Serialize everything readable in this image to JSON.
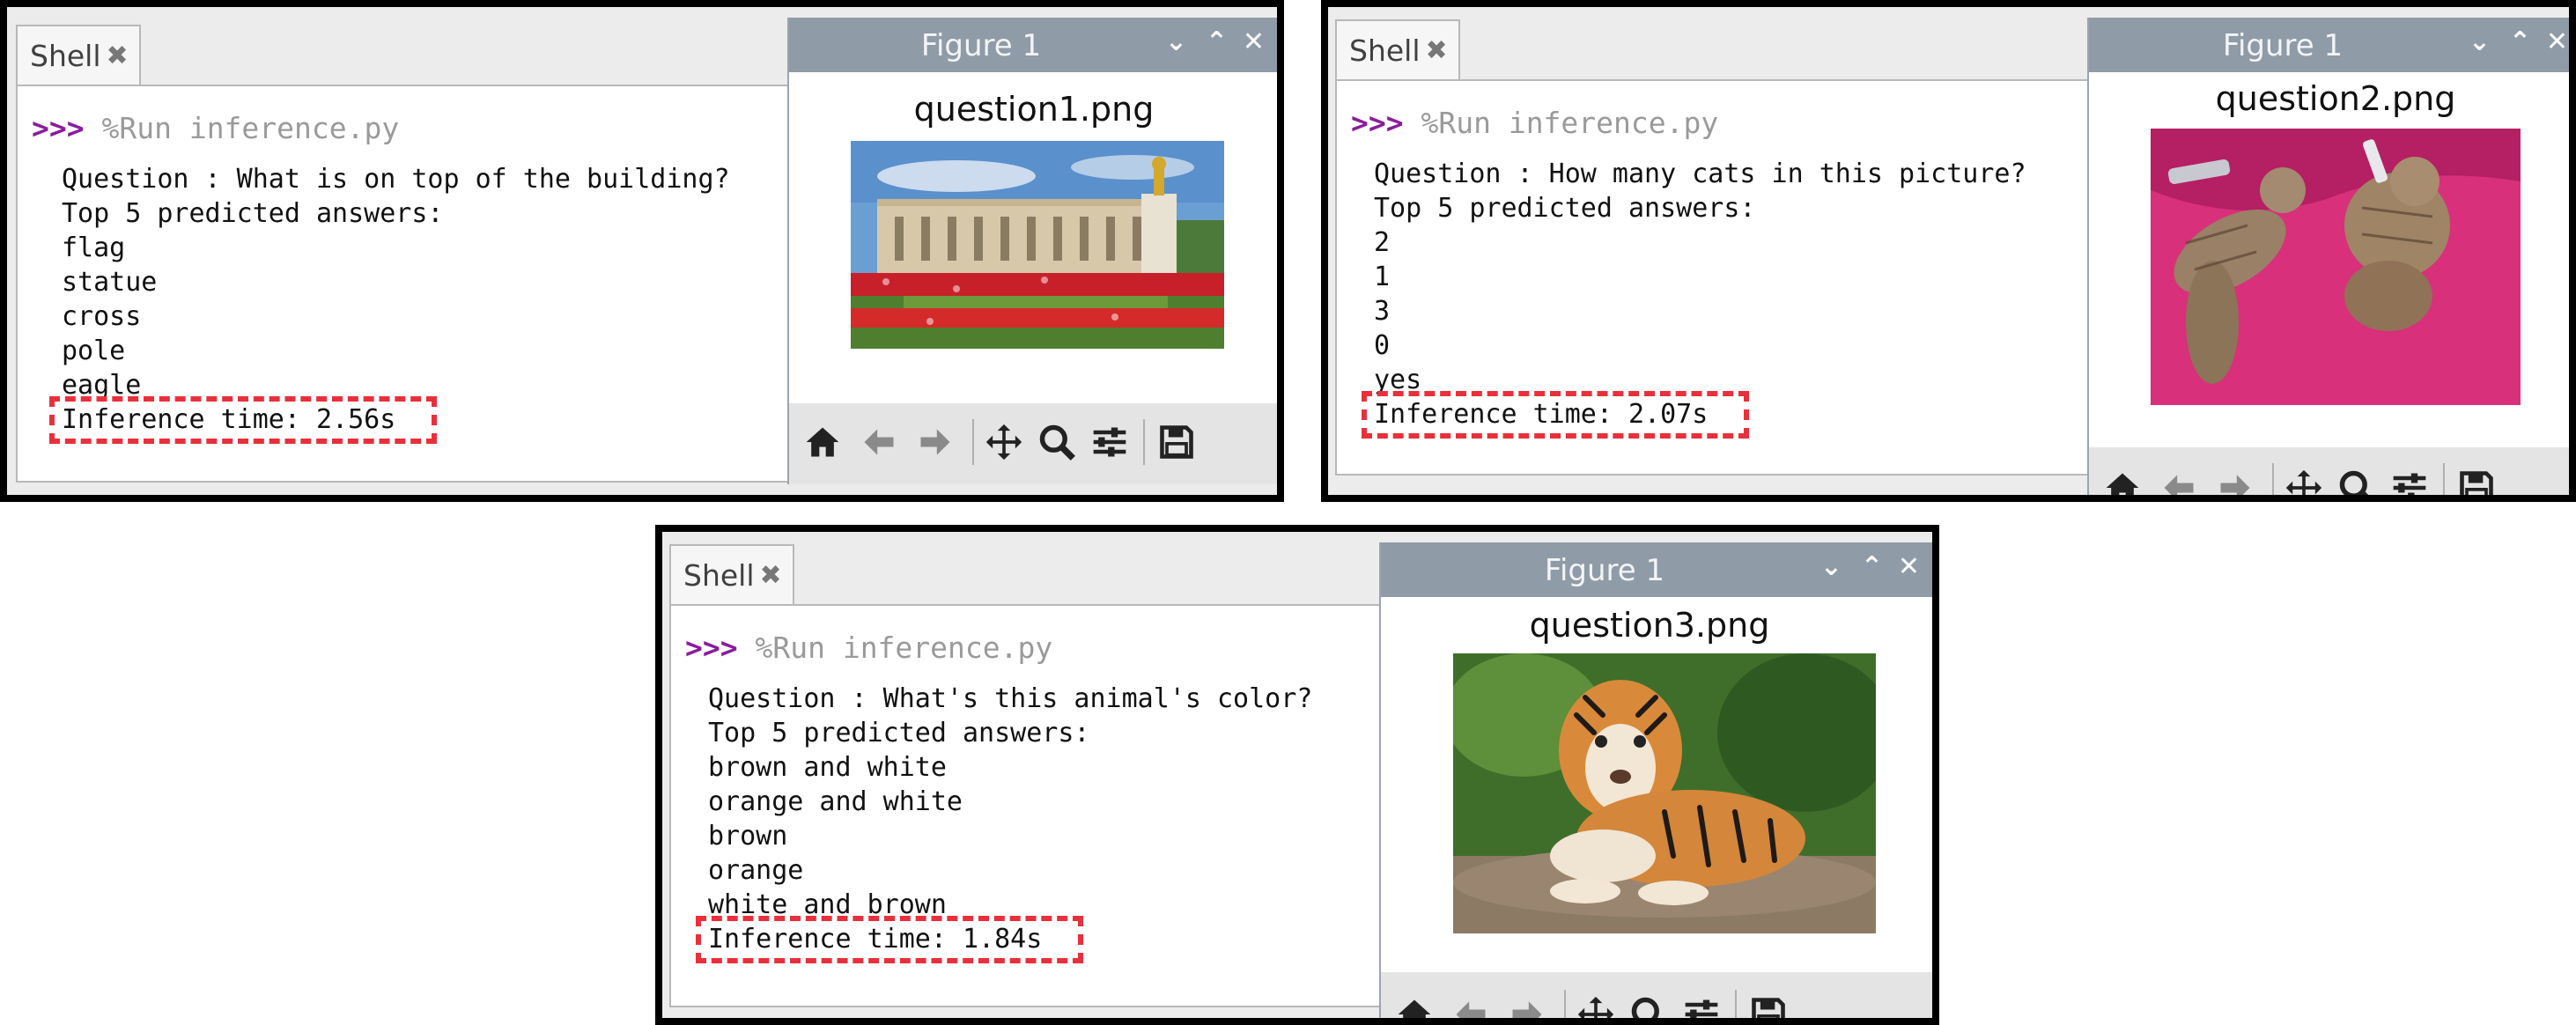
{
  "panels": [
    {
      "shell_tab": "Shell",
      "prompt": ">>>",
      "command": "%Run inference.py",
      "question": "Question : What is on top of the building?",
      "top_label": "Top 5 predicted answers:",
      "answers": [
        "flag",
        "statue",
        "cross",
        "pole",
        "eagle"
      ],
      "inference_time": "Inference time: 2.56s",
      "figure_title": "Figure 1",
      "image_name": "question1.png"
    },
    {
      "shell_tab": "Shell",
      "prompt": ">>>",
      "command": "%Run inference.py",
      "question": "Question : How many cats in this picture?",
      "top_label": "Top 5 predicted answers:",
      "answers": [
        "2",
        "1",
        "3",
        "0",
        "yes"
      ],
      "inference_time": "Inference time: 2.07s",
      "figure_title": "Figure 1",
      "image_name": "question2.png"
    },
    {
      "shell_tab": "Shell",
      "prompt": ">>>",
      "command": "%Run inference.py",
      "question": "Question : What's this animal's color?",
      "top_label": "Top 5 predicted answers:",
      "answers": [
        "brown and white",
        "orange and white",
        "brown",
        "orange",
        "white and brown"
      ],
      "inference_time": "Inference time: 1.84s",
      "figure_title": "Figure 1",
      "image_name": "question3.png"
    }
  ],
  "icons": {
    "tab_close": "close-icon",
    "window_controls": [
      "chevron-down-icon",
      "chevron-up-icon",
      "close-icon"
    ],
    "toolbar": [
      "home-icon",
      "back-arrow-icon",
      "forward-arrow-icon",
      "pan-icon",
      "zoom-icon",
      "settings-sliders-icon",
      "save-icon"
    ]
  },
  "colors": {
    "prompt": "#8a1c9e",
    "highlight": "#e8303a",
    "figure_titlebar": "#8f9ba7"
  }
}
